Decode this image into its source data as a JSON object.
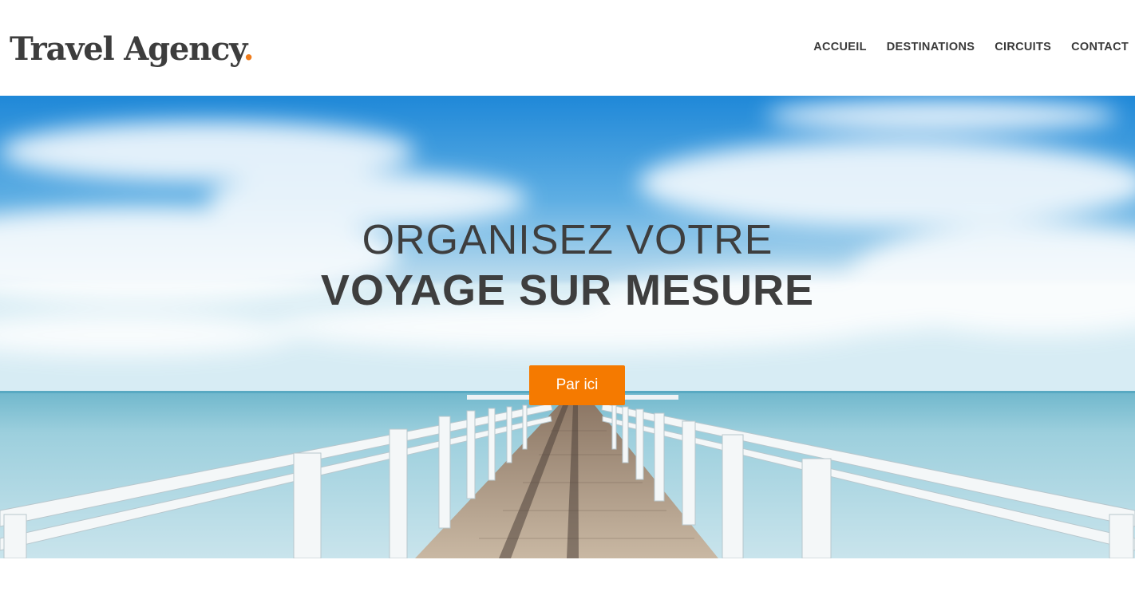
{
  "brand": {
    "name": "Travel Agency",
    "dot": ".",
    "accent_color": "#f07c1b"
  },
  "nav": {
    "items": [
      {
        "label": "ACCUEIL"
      },
      {
        "label": "DESTINATIONS"
      },
      {
        "label": "CIRCUITS"
      },
      {
        "label": "CONTACT"
      }
    ]
  },
  "hero": {
    "line1": "ORGANISEZ VOTRE",
    "line2": "VOYAGE SUR MESURE",
    "button_label": "Par ici",
    "button_color": "#f57a00"
  }
}
